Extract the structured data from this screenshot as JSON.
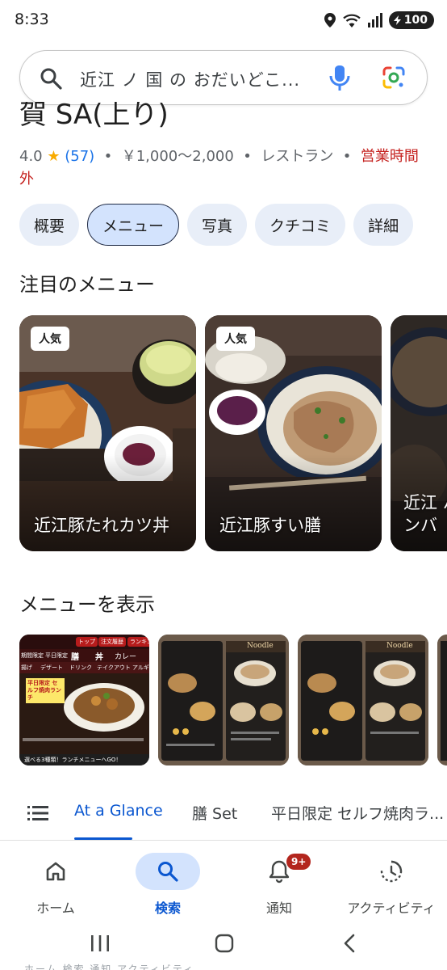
{
  "status_bar": {
    "time": "8:33",
    "battery": "100"
  },
  "search": {
    "query": "近江 ノ 国 の おだいどこ..."
  },
  "place": {
    "title_partial": "賀 SA(上り)",
    "rating": "4.0",
    "star": "★",
    "review_count": "(57)",
    "price": "￥1,000～2,000",
    "category": "レストラン",
    "hours_status": "営業時間外",
    "separator": "•"
  },
  "chips": [
    {
      "label": "概要"
    },
    {
      "label": "メニュー"
    },
    {
      "label": "写真"
    },
    {
      "label": "クチコミ"
    },
    {
      "label": "詳細"
    }
  ],
  "featured": {
    "title": "注目のメニュー",
    "cards": [
      {
        "badge": "人気",
        "name": "近江豚たれカツ丼"
      },
      {
        "badge": "人気",
        "name": "近江豚すい膳"
      },
      {
        "badge": "",
        "name": "近江 ハンバ"
      }
    ]
  },
  "menu_photos": {
    "title": "メニューを表示",
    "photo1": {
      "tabs": [
        "トップ",
        "注文履歴",
        "ランキング"
      ],
      "row1": [
        "膳",
        "丼",
        "カレー"
      ],
      "row2": [
        "デザート",
        "ドリンク",
        "テイクアウト"
      ],
      "tags": [
        "期間限定",
        "平日限定",
        "揚げ",
        "アルギー"
      ],
      "promo": "平日限定 セルフ焼肉ランチ",
      "footer": "選べる3種類！ランチメニューへGO！"
    },
    "noodle_label": "Noodle"
  },
  "tabs": [
    {
      "label": "At a Glance"
    },
    {
      "label": "膳 Set"
    },
    {
      "label": "平日限定 セルフ焼肉ラ..."
    }
  ],
  "bottom_nav": [
    {
      "label": "ホーム"
    },
    {
      "label": "検索"
    },
    {
      "label": "通知",
      "badge": "9+"
    },
    {
      "label": "アクティビティ"
    }
  ],
  "system_nav_ghost": "ホーム  検索  通知  アクティビティ",
  "colors": {
    "accent": "#0b57d0",
    "chip_bg": "#e8eef8",
    "closed_red": "#c5221f",
    "star_yellow": "#f9ab00"
  }
}
